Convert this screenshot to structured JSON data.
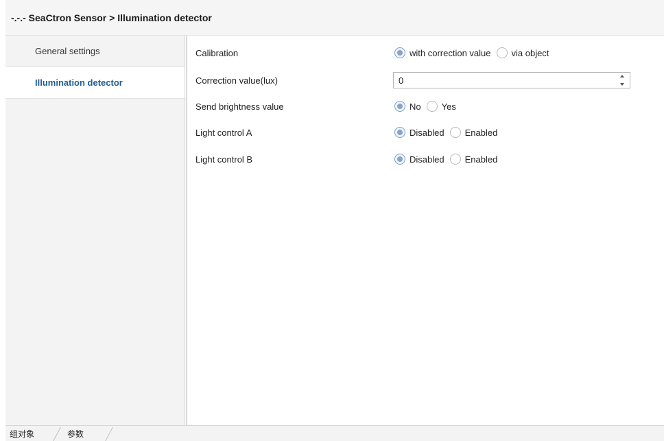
{
  "window": {
    "title": "-.-.- SeaCtron Sensor > Illumination detector"
  },
  "sidebar": {
    "items": [
      {
        "label": "General settings",
        "active": false
      },
      {
        "label": "Illumination detector",
        "active": true
      }
    ]
  },
  "params": {
    "calibration": {
      "label": "Calibration",
      "options": [
        "with correction value",
        "via object"
      ],
      "selected": "with correction value"
    },
    "correction_value": {
      "label": "Correction value(lux)",
      "value": "0"
    },
    "send_brightness": {
      "label": "Send brightness value",
      "options": [
        "No",
        "Yes"
      ],
      "selected": "No"
    },
    "light_control_a": {
      "label": "Light control A",
      "options": [
        "Disabled",
        "Enabled"
      ],
      "selected": "Disabled"
    },
    "light_control_b": {
      "label": "Light control B",
      "options": [
        "Disabled",
        "Enabled"
      ],
      "selected": "Disabled"
    }
  },
  "bottom_tabs": [
    {
      "label": "组对象",
      "active": false
    },
    {
      "label": "参数",
      "active": true
    }
  ],
  "icons": {
    "spin_up": "spin-up-arrow-icon",
    "spin_down": "spin-down-arrow-icon"
  },
  "colors": {
    "active_nav_text": "#1f5d94",
    "radio_checked": "#8aa3c2"
  }
}
